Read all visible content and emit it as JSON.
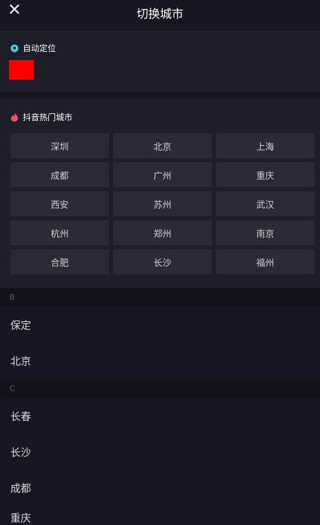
{
  "header": {
    "title": "切换城市",
    "close_icon": "close-icon"
  },
  "auto_location": {
    "label": "自动定位",
    "icon": "location-pin-icon",
    "icon_color": "#3fd2e6"
  },
  "hot_cities": {
    "label": "抖音热门城市",
    "icon": "flame-icon",
    "icon_color": "#f24f6a",
    "cities": [
      "深圳",
      "北京",
      "上海",
      "成都",
      "广州",
      "重庆",
      "西安",
      "苏州",
      "武汉",
      "杭州",
      "郑州",
      "南京",
      "合肥",
      "长沙",
      "福州"
    ]
  },
  "index": [
    {
      "letter": "B",
      "cities": [
        "保定",
        "北京"
      ]
    },
    {
      "letter": "C",
      "cities": [
        "长春",
        "长沙",
        "成都",
        "重庆"
      ]
    }
  ]
}
